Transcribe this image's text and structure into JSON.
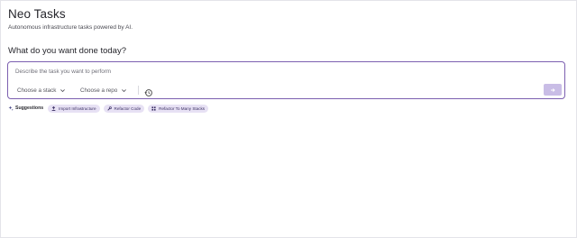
{
  "app": {
    "title": "Neo Tasks",
    "subtitle": "Autonomous infrastructure tasks powered by AI."
  },
  "prompt": {
    "heading": "What do you want done today?",
    "placeholder": "Describe the task you want to perform",
    "value": ""
  },
  "controls": {
    "stack_label": "Choose a stack",
    "repo_label": "Choose a repo"
  },
  "suggestions": {
    "label": "Suggestions",
    "items": [
      {
        "label": "Import Infrastructure",
        "icon": "upload-icon"
      },
      {
        "label": "Refactor Code",
        "icon": "wrench-icon"
      },
      {
        "label": "Refactor To Many Stacks",
        "icon": "grid-icon"
      }
    ]
  },
  "colors": {
    "accent": "#7c5fb0",
    "chip_bg": "#e7e1f4",
    "send_disabled": "#c9bde6"
  }
}
